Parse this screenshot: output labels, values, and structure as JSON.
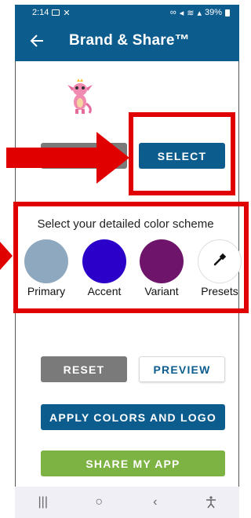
{
  "status": {
    "time": "2:14",
    "battery": "39%"
  },
  "appbar": {
    "title": "Brand & Share™"
  },
  "buttons": {
    "select": "SELECT",
    "reset": "RESET",
    "preview": "PREVIEW",
    "apply": "APPLY COLORS AND LOGO",
    "share": "SHARE MY APP"
  },
  "scheme": {
    "title": "Select your detailed color scheme",
    "swatches": [
      {
        "label": "Primary",
        "color": "#8ea9bf"
      },
      {
        "label": "Accent",
        "color": "#2b00c8"
      },
      {
        "label": "Variant",
        "color": "#6e156b"
      },
      {
        "label": "Presets",
        "color": "#ffffff",
        "icon": "eyedropper-icon"
      }
    ]
  },
  "colors": {
    "brand": "#0d5c8e",
    "highlight": "#e00000",
    "share": "#7cb342",
    "reset": "#7a7a7a"
  },
  "navbar": {
    "recents": "|||",
    "home": "○",
    "back": "‹"
  }
}
